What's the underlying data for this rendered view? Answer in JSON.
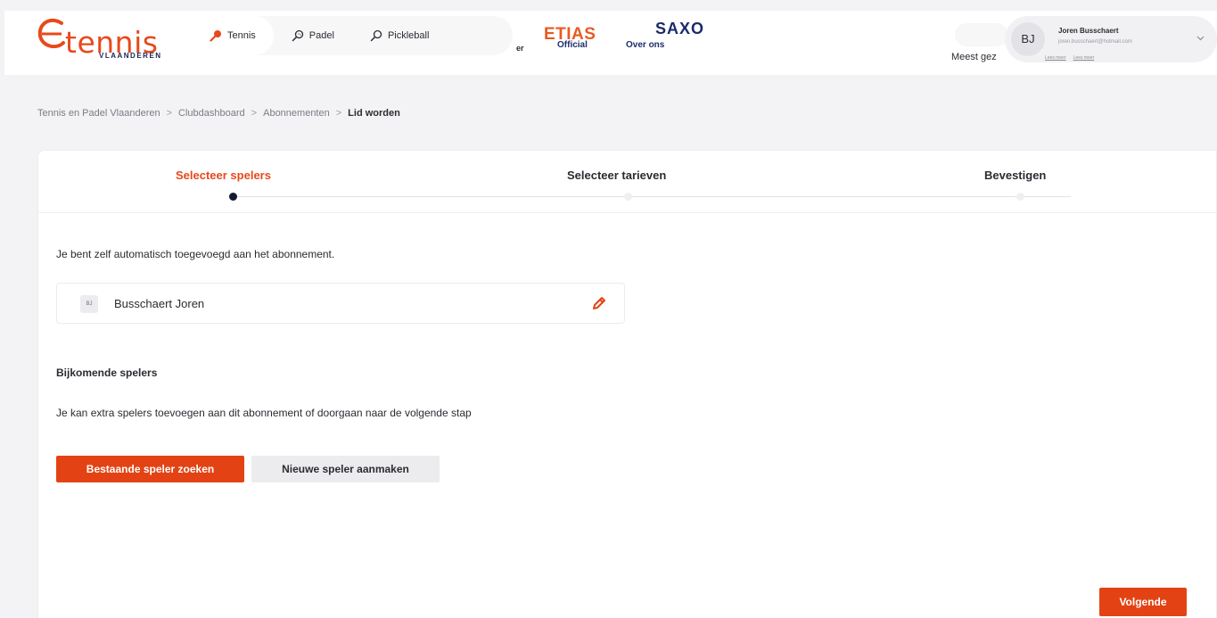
{
  "header": {
    "logo_text": "tennis",
    "logo_subtitle": "VLAANDEREN",
    "nav": [
      {
        "label": "Tennis",
        "icon": "tennis-racket-icon",
        "active": true
      },
      {
        "label": "Padel",
        "icon": "padel-racket-icon",
        "active": false
      },
      {
        "label": "Pickleball",
        "icon": "pickleball-paddle-icon",
        "active": false
      }
    ],
    "nav_fragment": "er",
    "sponsors": {
      "etias": "ETIAS",
      "etias_sub": "Official",
      "saxo": "SAXO",
      "saxo_sub": "Over ons"
    },
    "user": {
      "initials": "BJ",
      "name": "Joren Busschaert",
      "email": "joren.busschaert@hotmail.com"
    },
    "meest_label": "Meest gez",
    "meest_links": [
      "Lees meer",
      "Lees meer"
    ]
  },
  "breadcrumb": [
    "Tennis en Padel Vlaanderen",
    "Clubdashboard",
    "Abonnementen",
    "Lid worden"
  ],
  "breadcrumb_separator": ">",
  "stepper": {
    "steps": [
      {
        "label": "Selecteer spelers",
        "active": true
      },
      {
        "label": "Selecteer tarieven",
        "active": false
      },
      {
        "label": "Bevestigen",
        "active": false
      }
    ]
  },
  "main": {
    "intro": "Je bent zelf automatisch toegevoegd aan het abonnement.",
    "player": {
      "initials": "BJ",
      "name": "Busschaert Joren"
    },
    "section_title": "Bijkomende spelers",
    "section_desc": "Je kan extra spelers toevoegen aan dit abonnement of doorgaan naar de volgende stap",
    "btn_search": "Bestaande speler zoeken",
    "btn_new": "Nieuwe speler aanmaken",
    "btn_next": "Volgende"
  },
  "colors": {
    "accent": "#e34314",
    "brand_orange": "#e8491b",
    "navy": "#141833"
  }
}
